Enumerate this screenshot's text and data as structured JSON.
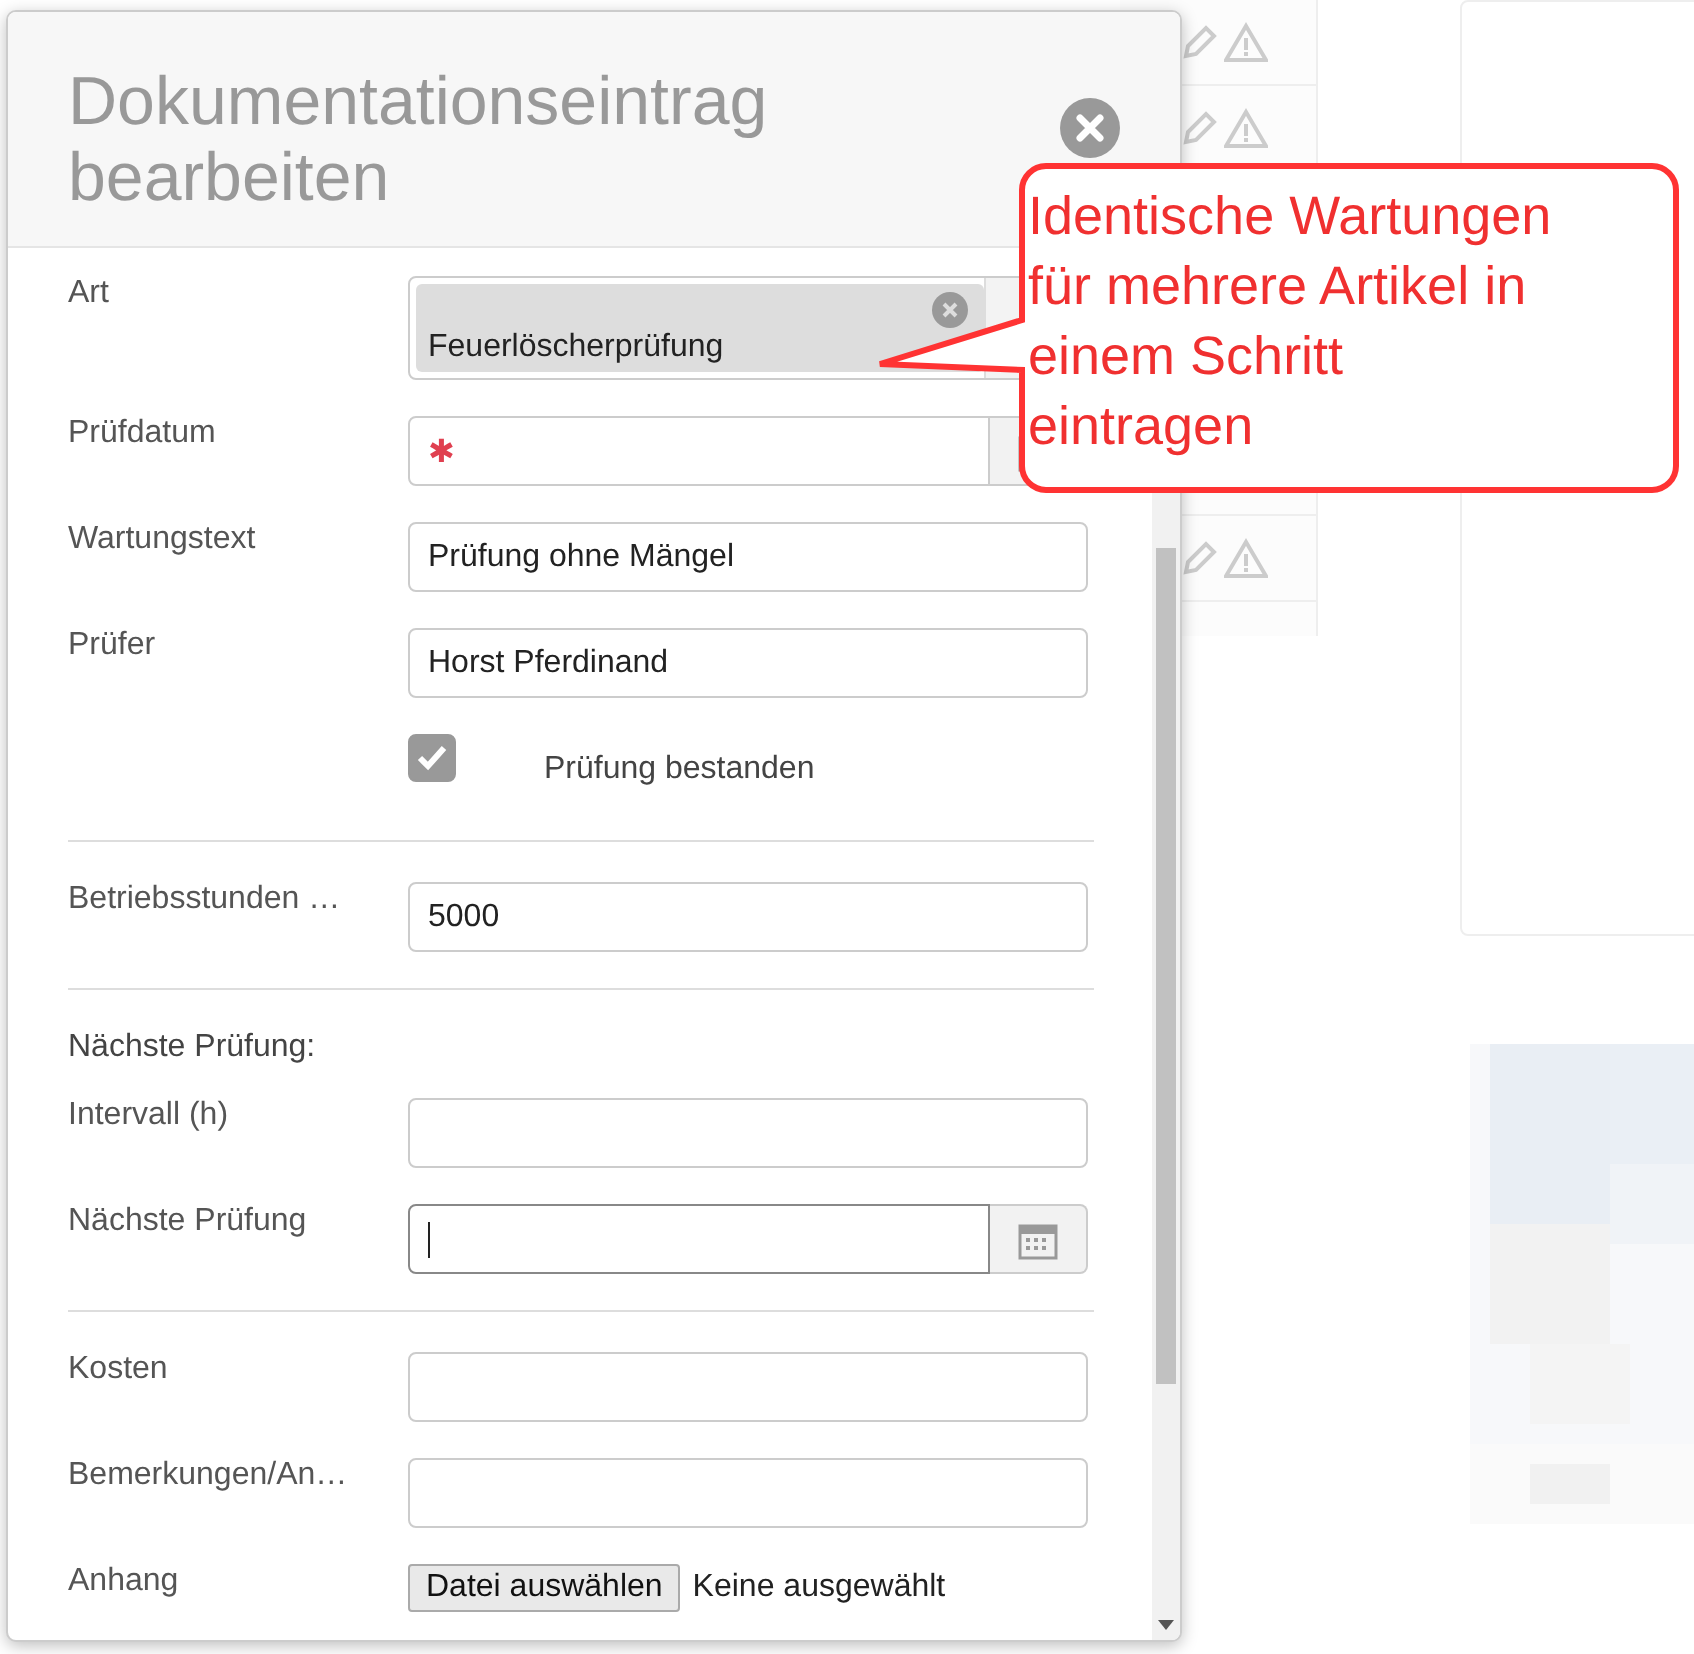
{
  "dialog": {
    "title": "Dokumentationseintrag bearbeiten",
    "fields": [
      {
        "kind": "chip",
        "label": "Art",
        "value": "Feuerlöscherprüfung"
      },
      {
        "kind": "date",
        "label": "Prüfdatum",
        "required_mark": "✱"
      },
      {
        "kind": "text",
        "label": "Wartungstext",
        "value": "Prüfung ohne Mängel"
      },
      {
        "kind": "text",
        "label": "Prüfer",
        "value": "Horst Pferdinand"
      },
      {
        "kind": "checkbox",
        "label": "Prüfung bestanden",
        "checked": true
      },
      {
        "kind": "divider"
      },
      {
        "kind": "text",
        "label": "Betriebsstunden …",
        "value": "5000"
      },
      {
        "kind": "divider"
      },
      {
        "kind": "heading",
        "label": "Nächste Prüfung:"
      },
      {
        "kind": "text",
        "label": "Intervall (h)"
      },
      {
        "kind": "date",
        "label": "Nächste Prüfung",
        "focused": true
      },
      {
        "kind": "divider"
      },
      {
        "kind": "text",
        "label": "Kosten"
      },
      {
        "kind": "text",
        "label": "Bemerkungen/An…"
      },
      {
        "kind": "file",
        "label": "Anhang",
        "button": "Datei auswählen",
        "status": "Keine ausgewählt"
      }
    ]
  },
  "callout": {
    "text": "Identische Wartungen für mehrere Artikel in einem Schritt eintragen"
  }
}
